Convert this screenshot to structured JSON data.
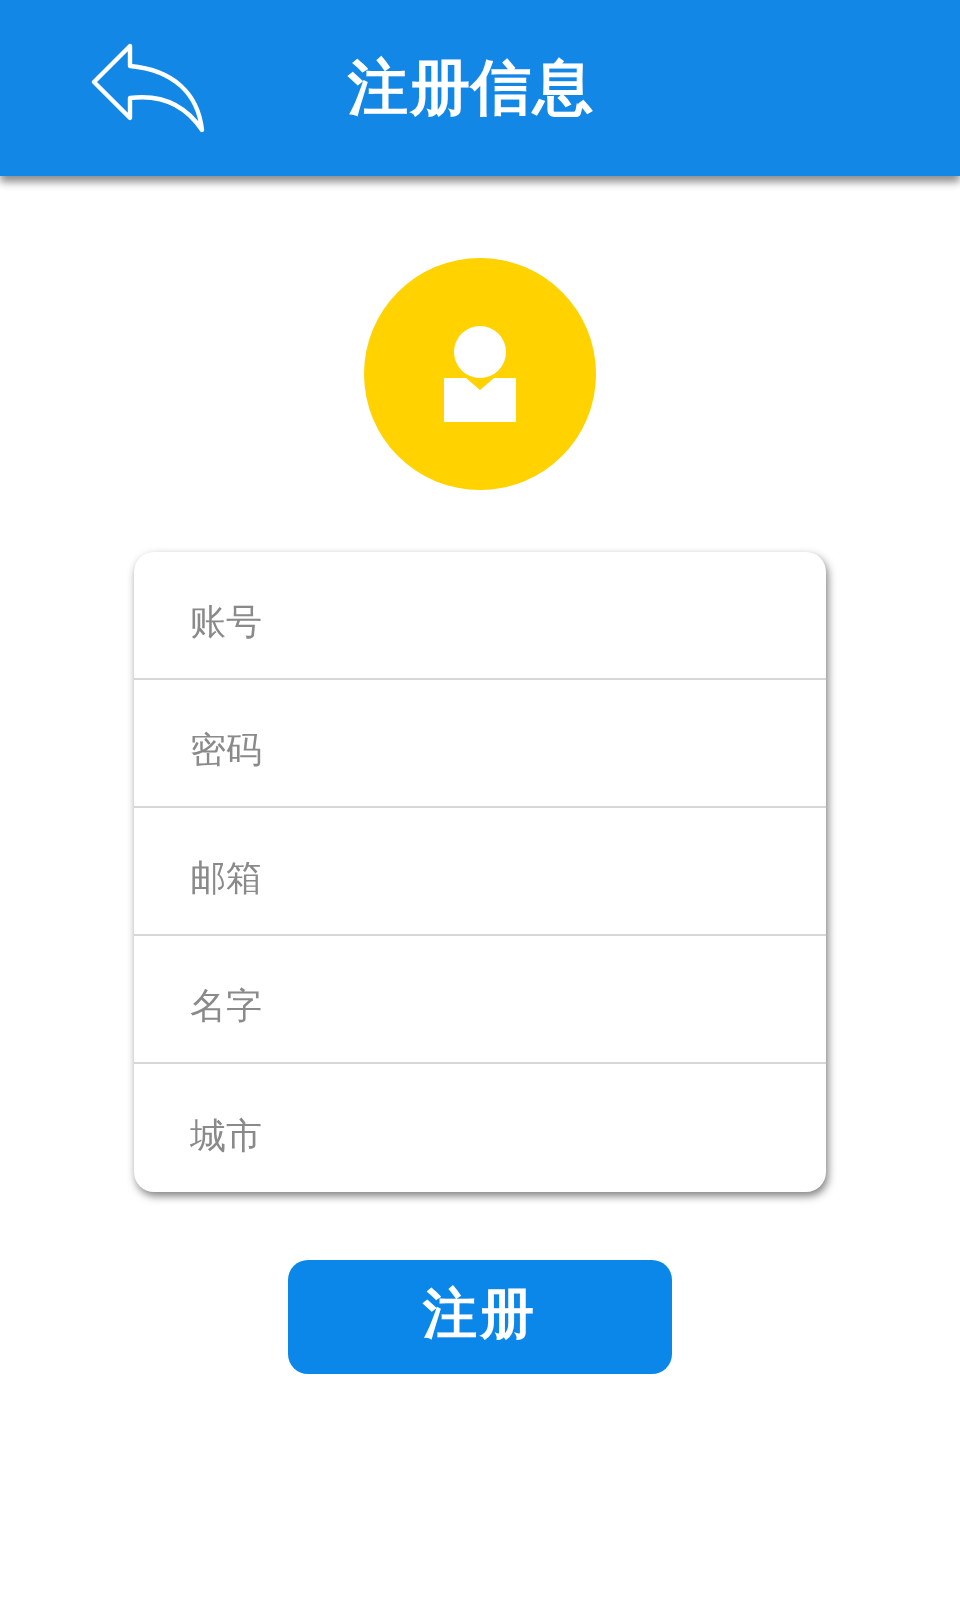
{
  "header": {
    "title": "注册信息"
  },
  "fields": [
    {
      "placeholder": "账号"
    },
    {
      "placeholder": "密码"
    },
    {
      "placeholder": "邮箱"
    },
    {
      "placeholder": "名字"
    },
    {
      "placeholder": "城市"
    }
  ],
  "submit_button": {
    "label": "注册"
  }
}
